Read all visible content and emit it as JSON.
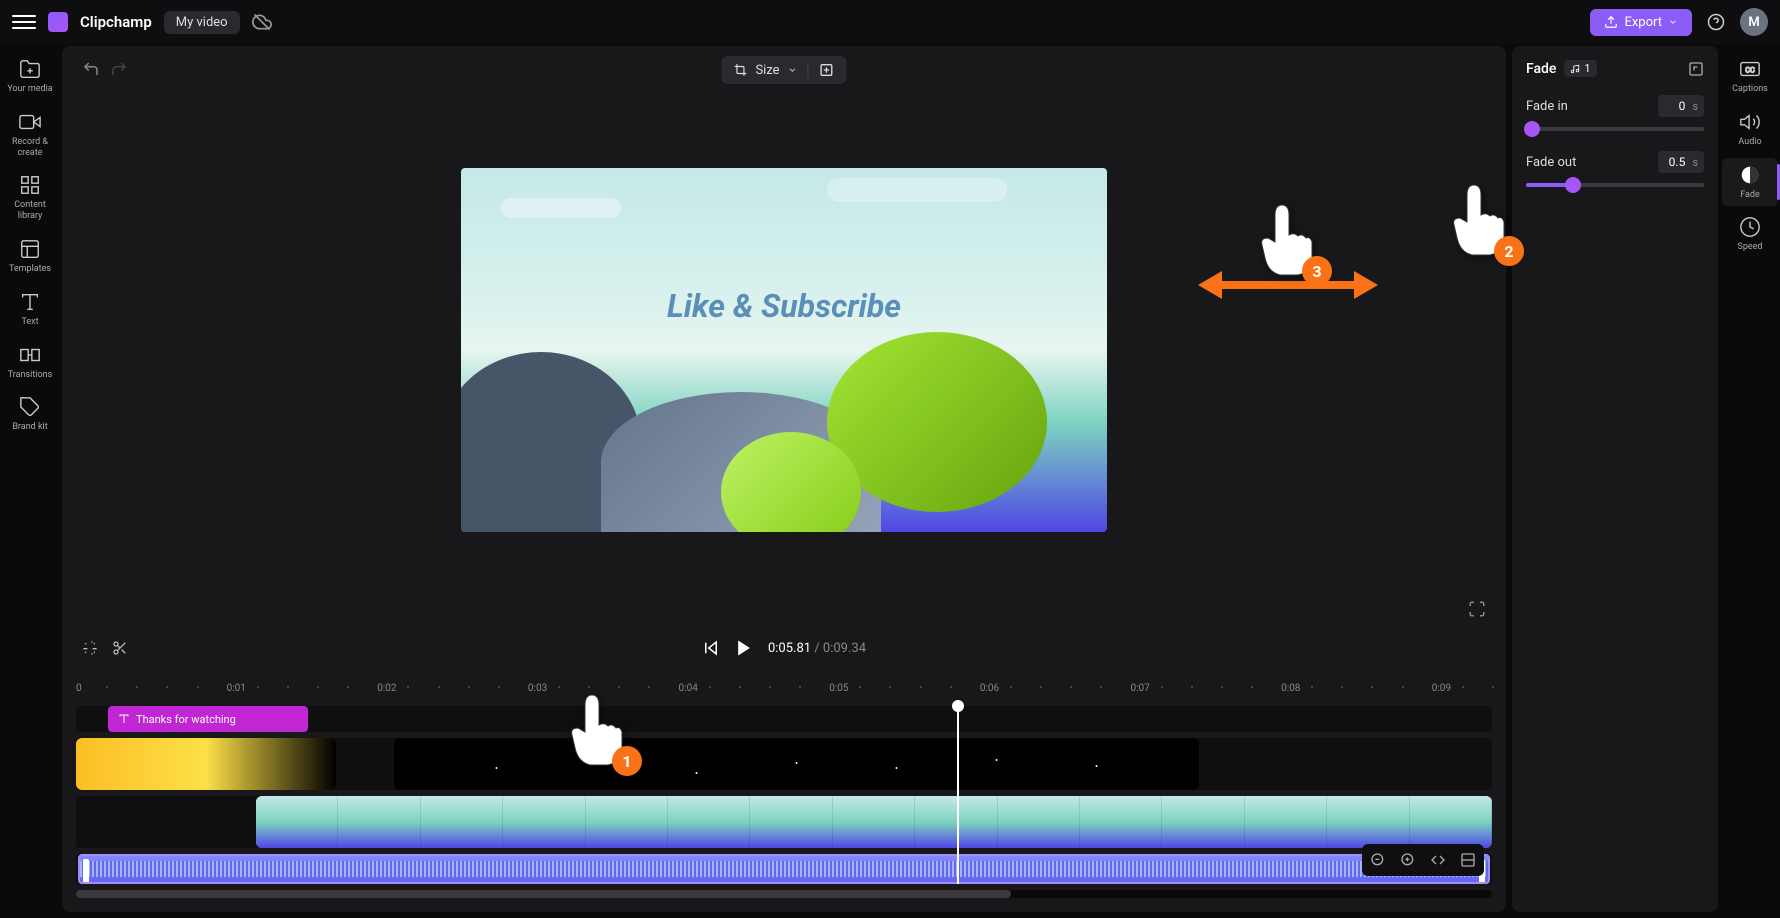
{
  "brand": "Clipchamp",
  "project_name": "My video",
  "export_label": "Export",
  "avatar_letter": "M",
  "left_nav": [
    {
      "label": "Your media"
    },
    {
      "label": "Record & create"
    },
    {
      "label": "Content library"
    },
    {
      "label": "Templates"
    },
    {
      "label": "Text"
    },
    {
      "label": "Transitions"
    },
    {
      "label": "Brand kit"
    }
  ],
  "size_label": "Size",
  "preview_text": "Like & Subscribe",
  "timecode_current": "0:05.81",
  "timecode_total": "0:09.34",
  "ruler_ticks": [
    "0",
    "0:01",
    "0:02",
    "0:03",
    "0:04",
    "0:05",
    "0:06",
    "0:07",
    "0:08",
    "0:09"
  ],
  "text_clip_label": "Thanks for watching",
  "panel": {
    "title": "Fade",
    "badge_count": "1",
    "fade_in_label": "Fade in",
    "fade_in_value": "0",
    "fade_out_label": "Fade out",
    "fade_out_value": "0.5",
    "unit": "s"
  },
  "right_nav": [
    {
      "label": "Captions"
    },
    {
      "label": "Audio"
    },
    {
      "label": "Fade"
    },
    {
      "label": "Speed"
    }
  ],
  "annotations": {
    "1": "1",
    "2": "2",
    "3": "3"
  }
}
